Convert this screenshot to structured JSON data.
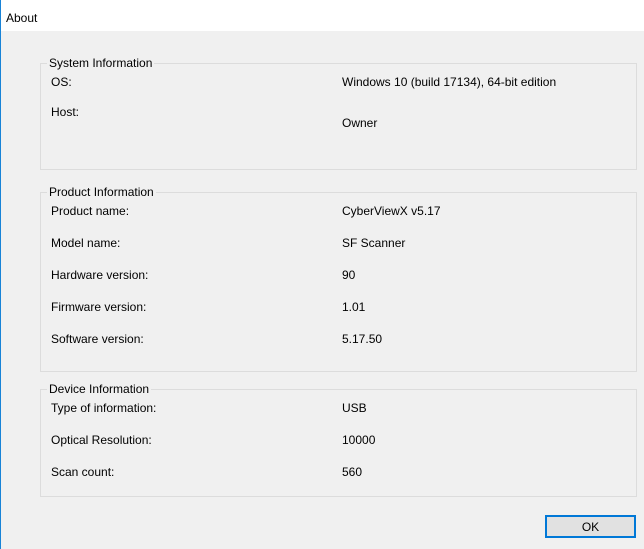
{
  "window": {
    "title": "About"
  },
  "system_info": {
    "legend": "System Information",
    "rows": [
      {
        "label": "OS:",
        "value": "Windows 10 (build 17134), 64-bit edition"
      },
      {
        "label": "Host:",
        "value": "Owner"
      }
    ]
  },
  "product_info": {
    "legend": "Product Information",
    "rows": [
      {
        "label": "Product name:",
        "value": "CyberViewX v5.17"
      },
      {
        "label": "Model name:",
        "value": "SF Scanner"
      },
      {
        "label": "Hardware version:",
        "value": "90"
      },
      {
        "label": "Firmware version:",
        "value": "1.01"
      },
      {
        "label": "Software version:",
        "value": "5.17.50"
      }
    ]
  },
  "device_info": {
    "legend": "Device Information",
    "rows": [
      {
        "label": "Type of information:",
        "value": "USB"
      },
      {
        "label": "Optical Resolution:",
        "value": "10000"
      },
      {
        "label": "Scan count:",
        "value": "560"
      }
    ]
  },
  "buttons": {
    "ok_label": "OK"
  },
  "colors": {
    "window_border": "#1883d7",
    "button_focus": "#0078d7",
    "client_bg": "#f0f0f0"
  }
}
